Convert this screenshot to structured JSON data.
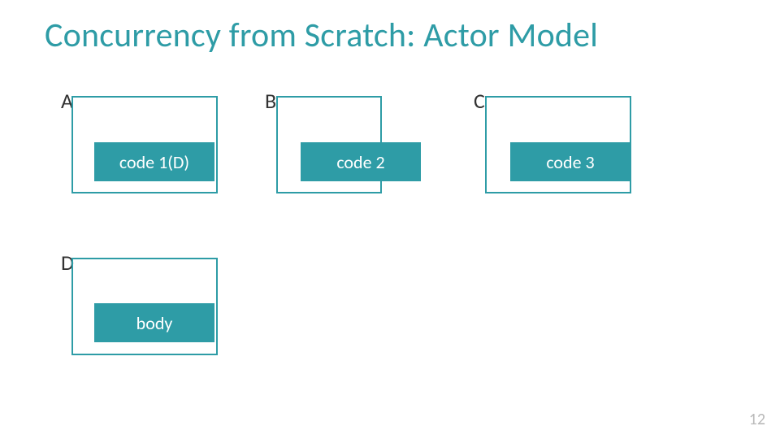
{
  "title": "Concurrency from Scratch: Actor Model",
  "actors": {
    "A": {
      "label": "A",
      "code": "code 1(D)"
    },
    "B": {
      "label": "B",
      "code": "code 2"
    },
    "C": {
      "label": "C",
      "code": "code 3"
    },
    "D": {
      "label": "D",
      "code": "body"
    }
  },
  "page_number": "12",
  "colors": {
    "accent": "#2e9ca6"
  }
}
